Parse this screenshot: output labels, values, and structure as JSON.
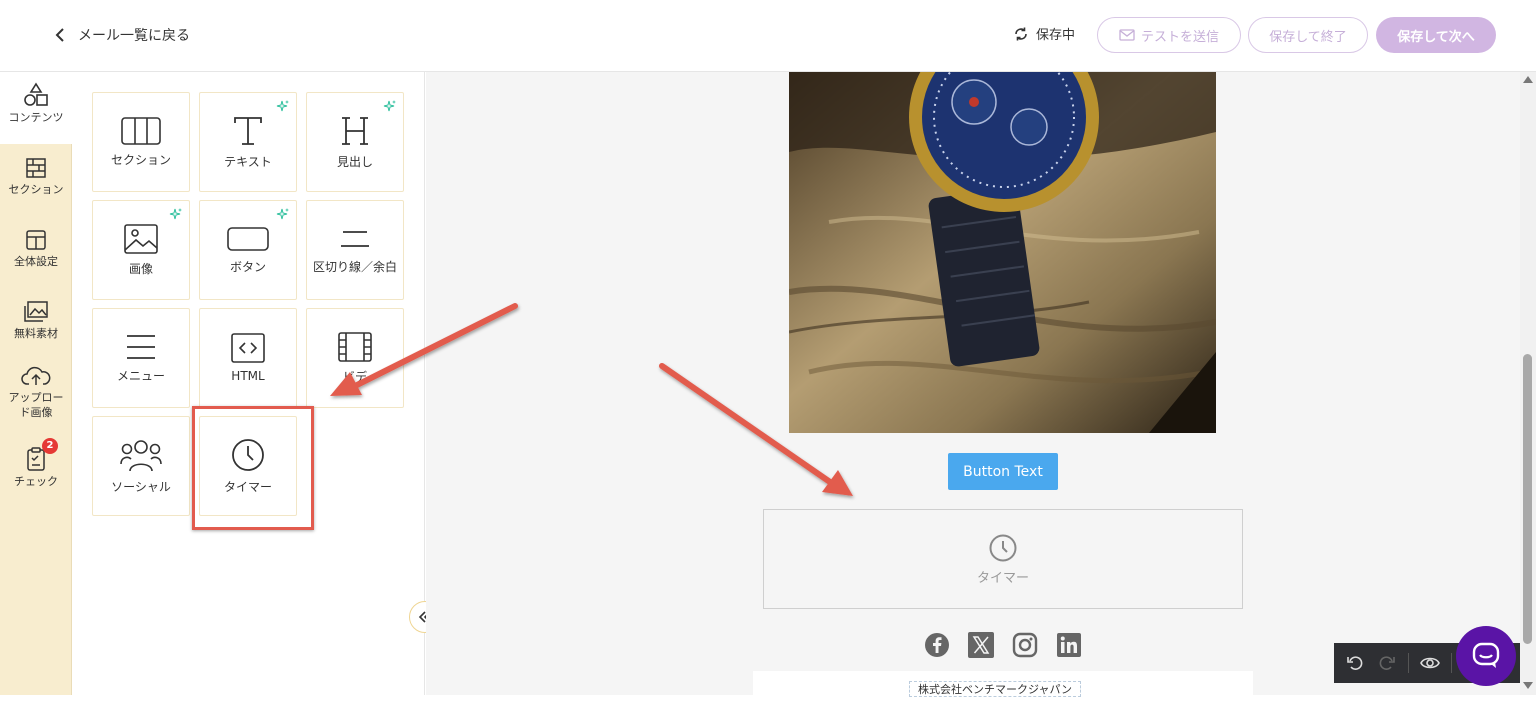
{
  "header": {
    "back_label": "メール一覧に戻る",
    "saving_label": "保存中",
    "test_send_label": "テストを送信",
    "save_exit_label": "保存して終了",
    "save_next_label": "保存して次へ"
  },
  "rail": {
    "items": [
      {
        "label": "コンテンツ",
        "icon": "shapes-icon"
      },
      {
        "label": "セクション",
        "icon": "bricks-icon"
      },
      {
        "label": "全体設定",
        "icon": "layout-icon"
      },
      {
        "label": "無料素材",
        "icon": "images-icon"
      },
      {
        "label": "アップロード画像",
        "icon": "cloud-upload-icon"
      },
      {
        "label": "チェック",
        "icon": "clipboard-check-icon",
        "badge": "2"
      }
    ]
  },
  "panel": {
    "tiles": [
      {
        "label": "セクション",
        "icon": "section-icon"
      },
      {
        "label": "テキスト",
        "icon": "text-icon"
      },
      {
        "label": "見出し",
        "icon": "heading-icon"
      },
      {
        "label": "画像",
        "icon": "image-icon"
      },
      {
        "label": "ボタン",
        "icon": "button-icon"
      },
      {
        "label": "区切り線／余白",
        "icon": "divider-icon"
      },
      {
        "label": "メニュー",
        "icon": "menu-icon"
      },
      {
        "label": "HTML",
        "icon": "code-icon"
      },
      {
        "label": "ビデ",
        "icon": "video-icon"
      },
      {
        "label": "ソーシャル",
        "icon": "social-icon"
      },
      {
        "label": "タイマー",
        "icon": "clock-icon"
      }
    ]
  },
  "canvas": {
    "button_text": "Button Text",
    "timer_label": "タイマー",
    "company": "株式会社ベンチマークジャパン"
  },
  "colors": {
    "accent": "#d1b6e2",
    "rail_bg": "#f8edcf",
    "arrow": "#e25b4e",
    "email_button": "#4aa8ee",
    "chat": "#5a14a6"
  }
}
